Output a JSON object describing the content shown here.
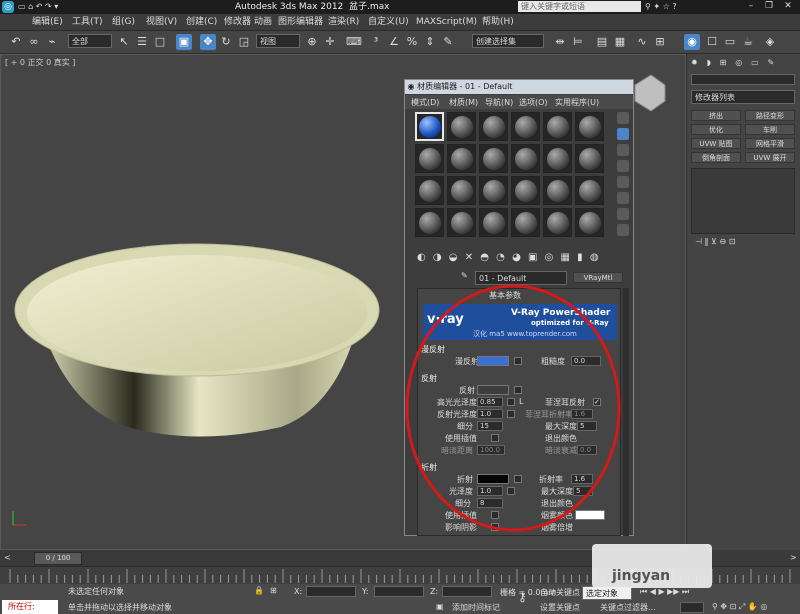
{
  "app": {
    "window_title": "Autodesk 3ds Max  2012",
    "window_title_tail": "盆子.max",
    "search_placeholder": "键入关键字或短语"
  },
  "menubar": {
    "items": [
      "编辑(E)",
      "工具(T)",
      "组(G)",
      "视图(V)",
      "创建(C)",
      "修改器",
      "动画",
      "图形编辑器",
      "渲染(R)",
      "自定义(U)",
      "MAXScript(M)",
      "帮助(H)"
    ]
  },
  "toolbar": {
    "selection_filter": "全部",
    "reference_coord": "视图",
    "named_selection": "创建选择集"
  },
  "viewport": {
    "label": "[ + 0 正交 0 真实 ]"
  },
  "command_panel": {
    "modifier_list": "修改器列表",
    "buttons": [
      "挤出",
      "路径变形",
      "优化",
      "车削",
      "UVW 贴图",
      "网格平滑",
      "倒角剖面",
      "UVW 展开"
    ]
  },
  "material_editor": {
    "title": "材质编辑器 - 01 - Default",
    "menu": [
      "模式(D)",
      "材质(M)",
      "导航(N)",
      "选项(O)",
      "实用程序(U)"
    ],
    "material_name": "01 - Default",
    "material_type": "VRayMtl",
    "rollout_title": "基本参数",
    "banner_logo": "v·ray",
    "banner_title": "V-Ray PowerShader",
    "banner_subtitle": "optimized for V-Ray",
    "banner_credit": "汉化  ma5 www.toprender.com",
    "diffuse": {
      "section": "漫反射",
      "diffuse_label": "漫反射",
      "roughness_label": "粗糙度",
      "roughness_value": "0.0",
      "diffuse_color": "#3a6fd8"
    },
    "reflection": {
      "section": "反射",
      "reflect_label": "反射",
      "hilight_gloss_label": "高光光泽度",
      "hilight_gloss_value": "0.85",
      "lock_label": "L",
      "fresnel_label": "菲涅耳反射",
      "fresnel_checked": true,
      "refl_gloss_label": "反射光泽度",
      "refl_gloss_value": "1.0",
      "fresnel_ior_label": "菲涅耳折射率",
      "fresnel_ior_value": "1.6",
      "subdivs_label": "细分",
      "subdivs_value": "15",
      "max_depth_label": "最大深度",
      "max_depth_value": "5",
      "use_interp_label": "使用插值",
      "exit_color_label": "退出颜色",
      "dim_distance_label": "暗淡距离",
      "dim_distance_value": "100.0",
      "dim_falloff_label": "暗淡衰减",
      "dim_falloff_value": "0.0"
    },
    "refraction": {
      "section": "折射",
      "refract_label": "折射",
      "ior_label": "折射率",
      "ior_value": "1.6",
      "gloss_label": "光泽度",
      "gloss_value": "1.0",
      "max_depth_label": "最大深度",
      "max_depth_value": "5",
      "subdivs_label": "细分",
      "subdivs_value": "8",
      "exit_color_label": "退出颜色",
      "use_interp_label": "使用插值",
      "fog_color_label": "烟雾颜色",
      "affect_shadows_label": "影响阴影",
      "fog_multiplier_label": "烟雾倍增"
    }
  },
  "timeline": {
    "frame": "0 / 100"
  },
  "statusbar": {
    "selection": "未选定任何对象",
    "prompt": "单击并拖动以选择并移动对象",
    "x_label": "X:",
    "y_label": "Y:",
    "z_label": "Z:",
    "grid": "栅格 = 0.0mm",
    "autokey": "自动关键点",
    "selected": "选定对象",
    "setkey": "设置关键点",
    "key_filters": "关键点过滤器...",
    "add_time_tag": "添加时间标记",
    "script_prompt": "所在行:",
    "watermark": "jingyan"
  },
  "colors": {
    "accent": "#4a86c7",
    "selection_circle": "#d61818",
    "bowl": "#dcdcb4"
  }
}
